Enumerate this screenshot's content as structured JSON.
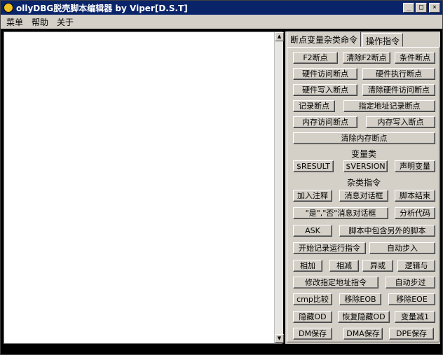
{
  "window": {
    "title": "ollyDBG脱壳脚本编辑器 by Viper[D.S.T]"
  },
  "caption_buttons": {
    "minimize": "_",
    "maximize": "□",
    "close": "×"
  },
  "menu": [
    "菜单",
    "帮助",
    "关于"
  ],
  "tabs": [
    "断点变量杂类命令",
    "操作指令"
  ],
  "sections": {
    "variables": "变量类",
    "misc": "杂类指令"
  },
  "buttons": {
    "f2_bp": "F2断点",
    "clear_f2_bp": "清除F2断点",
    "cond_bp": "条件断点",
    "hw_access_bp": "硬件访问断点",
    "hw_exec_bp": "硬件执行断点",
    "hw_write_bp": "硬件写入断点",
    "clear_hw_access_bp": "清除硬件访问断点",
    "log_bp": "记录断点",
    "addr_log_bp": "指定地址记录断点",
    "mem_access_bp": "内存访问断点",
    "mem_write_bp": "内存写入断点",
    "clear_mem_bp": "清除内存断点",
    "result": "$RESULT",
    "version": "$VERSION",
    "declare_var": "声明变量",
    "add_comment": "加入注释",
    "msg_dialog": "消息对话框",
    "script_end": "脚本结束",
    "yes_no_dialog": "\"是\",\"否\"消息对话框",
    "analyze_code": "分析代码",
    "ask": "ASK",
    "include_script": "脚本中包含另外的脚本",
    "start_trace": "开始记录运行指令",
    "auto_step_in": "自动步入",
    "add": "相加",
    "sub": "相减",
    "xor": "异或",
    "and": "逻辑与",
    "modify_addr": "修改指定地址指令",
    "auto_step_over": "自动步过",
    "cmp": "cmp比较",
    "shift_eob": "移除EOB",
    "shift_eoe": "移除EOE",
    "hide_od": "隐藏OD",
    "restore_hide_od": "恢复隐藏OD",
    "var_dec": "变量减1",
    "dm_save": "DM保存",
    "dma_save": "DMA保存",
    "dpe_save": "DPE保存"
  },
  "scrollbar": {
    "up": "▲",
    "down": "▼"
  }
}
